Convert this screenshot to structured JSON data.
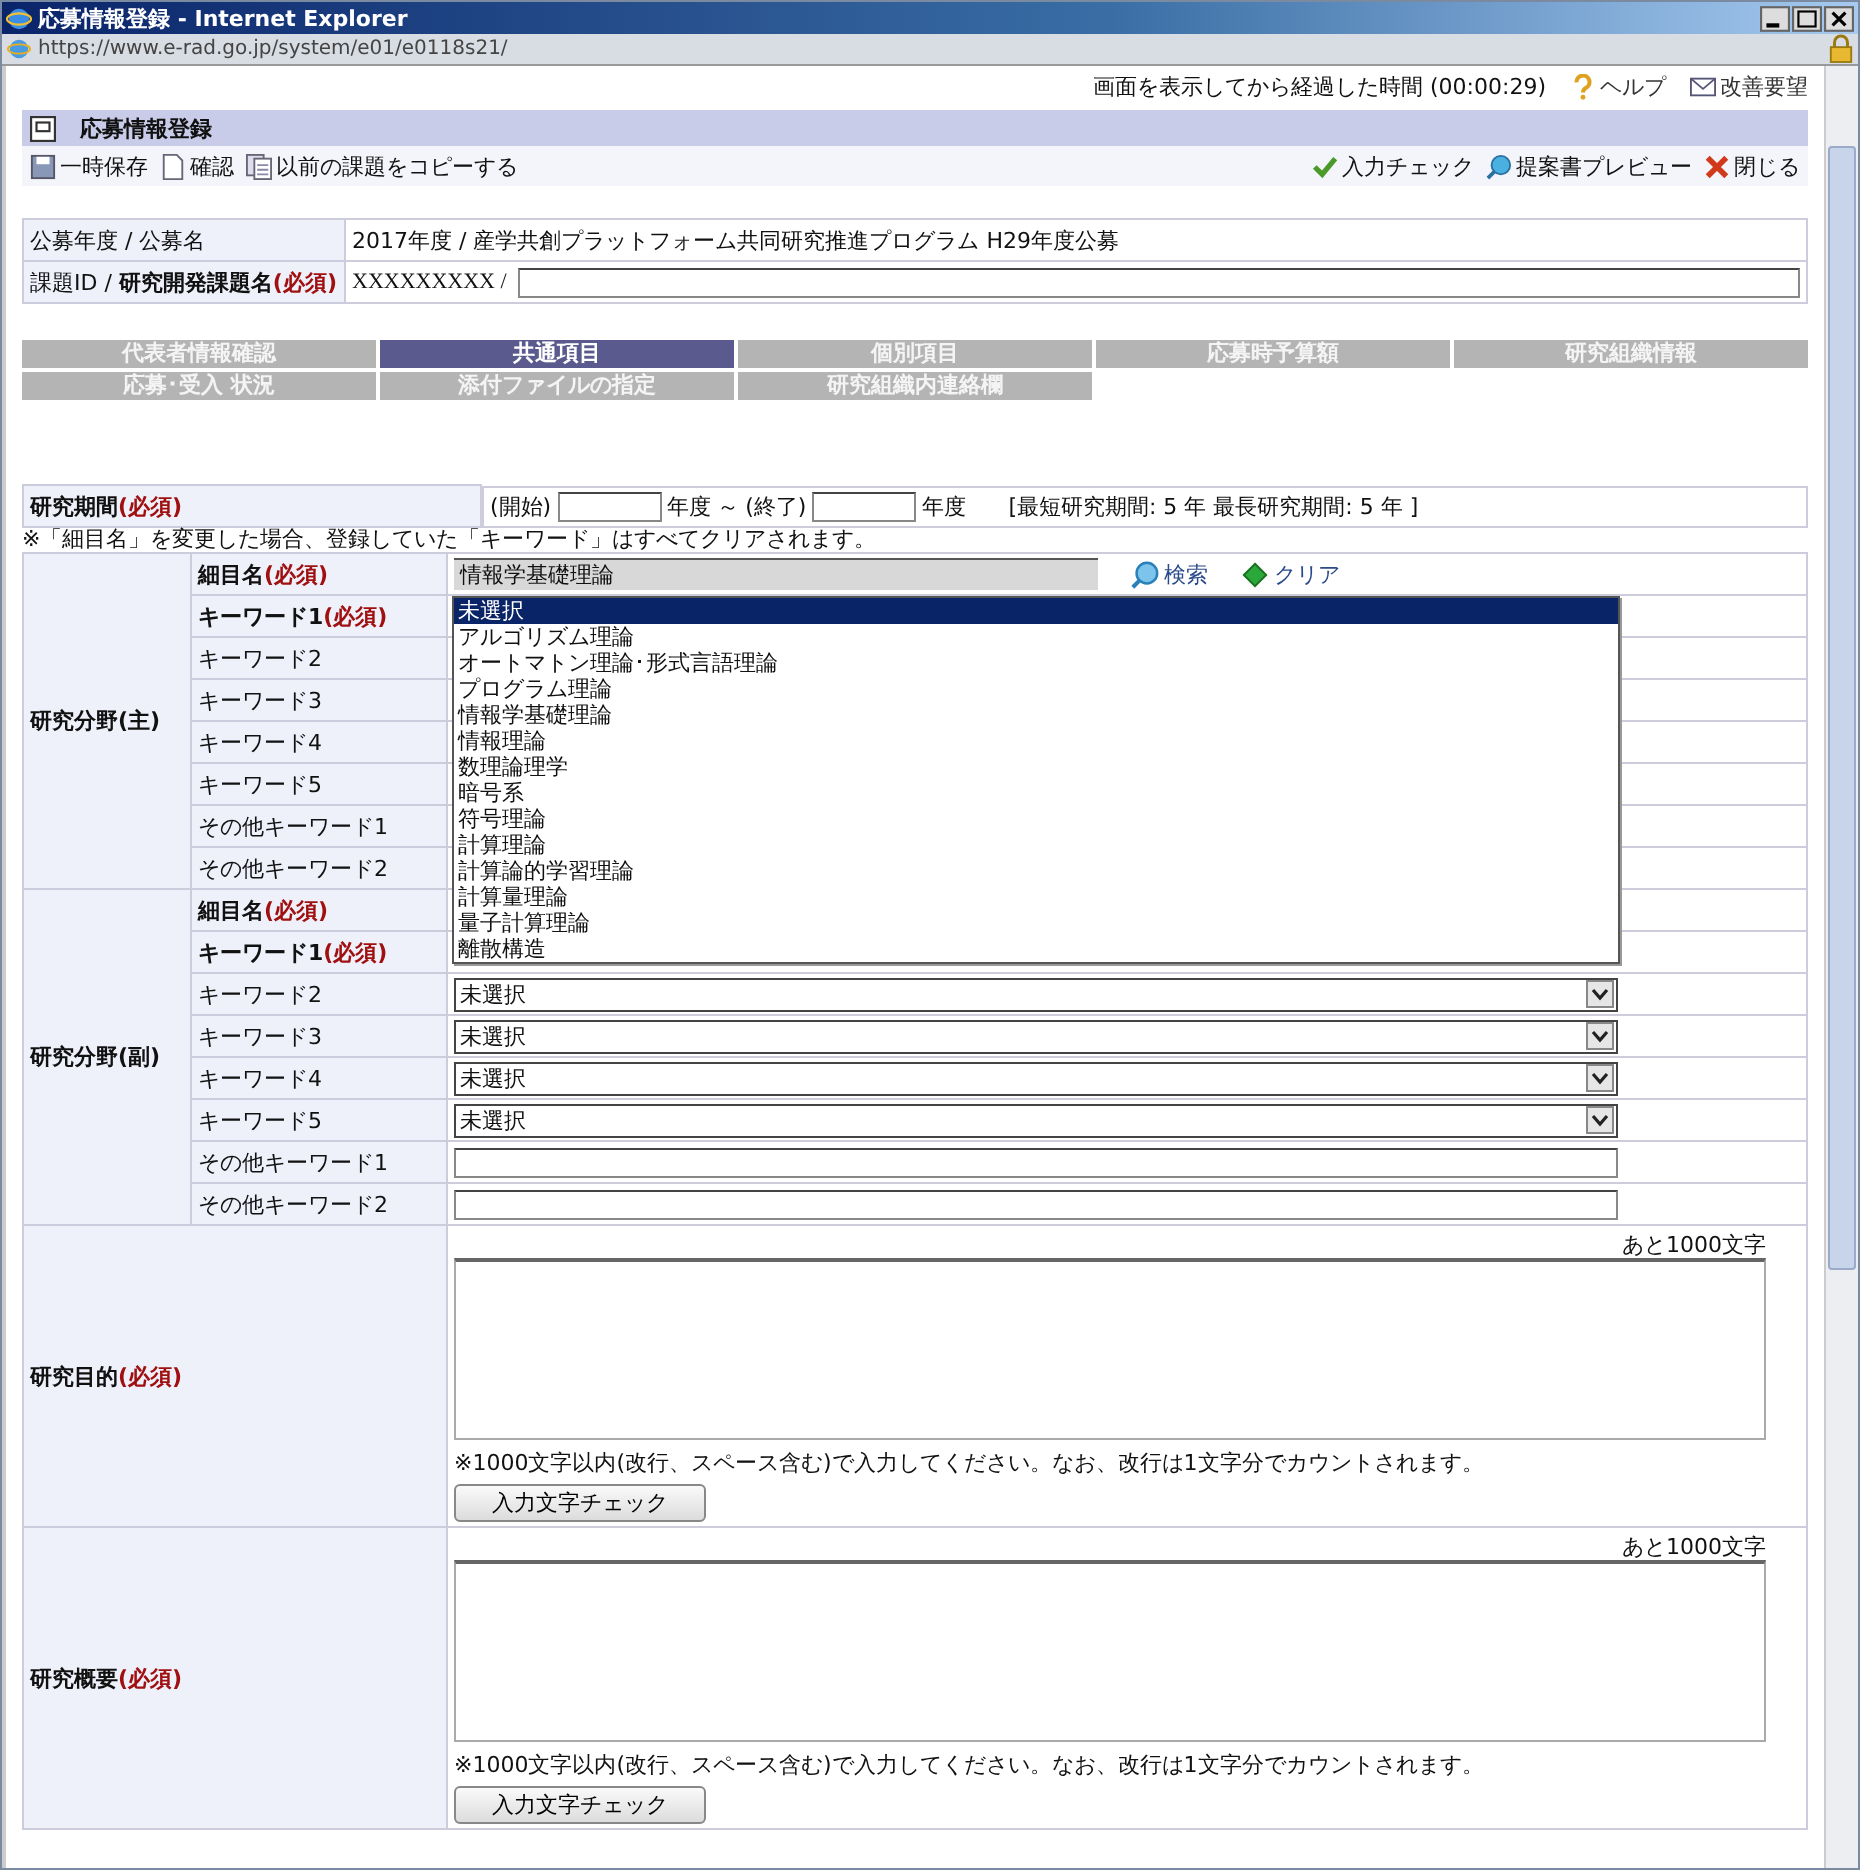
{
  "window": {
    "title": "応募情報登録 - Internet Explorer"
  },
  "address_bar": {
    "url": "https://www.e-rad.go.jp/system/e01/e0118s21/"
  },
  "top_bar": {
    "elapsed": "画面を表示してから経過した時間 (00:00:29)",
    "links": [
      {
        "label": "ヘルプ",
        "kind": "help"
      },
      {
        "label": "改善要望",
        "kind": "mail"
      }
    ]
  },
  "page_header": {
    "title": "応募情報登録"
  },
  "toolbar": {
    "left": [
      {
        "label": "一時保存",
        "kind": "save"
      },
      {
        "label": "確認",
        "kind": "doc"
      },
      {
        "label": "以前の課題をコピーする",
        "kind": "copy"
      }
    ],
    "right": [
      {
        "label": "入力チェック",
        "kind": "check"
      },
      {
        "label": "提案書プレビュー",
        "kind": "preview"
      },
      {
        "label": "閉じる",
        "kind": "close"
      }
    ]
  },
  "info_rows": [
    {
      "label": "公募年度 / 公募名",
      "kind": "text",
      "value": "2017年度 /  産学共創プラットフォーム共同研究推進プログラム  H29年度公募"
    },
    {
      "label": "課題ID / **研究開発課題名**",
      "required": "(必須)",
      "kind": "input",
      "value": "XXXXXXXXX /"
    }
  ],
  "tabs": [
    {
      "label": "代表者情報確認",
      "selected": false
    },
    {
      "label": "共通項目",
      "selected": true
    },
    {
      "label": "個別項目",
      "selected": false
    },
    {
      "label": "応募時予算額",
      "selected": false
    },
    {
      "label": "研究組織情報",
      "selected": false
    },
    {
      "label": "応募･受入 状況",
      "selected": false
    },
    {
      "label": "添付ファイルの指定",
      "selected": false
    },
    {
      "label": "研究組織内連絡欄",
      "selected": false
    }
  ],
  "period": {
    "label": "研究期間",
    "required": "(必須)",
    "start_label": "(開始)",
    "start_unit": "年度",
    "separator": "～",
    "end_label": "(終了)",
    "end_unit": "年度",
    "range": "[最短研究期間: 5 年  最長研究期間: 5 年 ]"
  },
  "note": "※「細目名」を変更した場合、登録していた「キーワード」はすべてクリアされます。",
  "field_groups": [
    {
      "label": "研究分野(主)",
      "rows": [
        {
          "label": "細目名",
          "required": "(必須)",
          "kind": "readonly",
          "value": "情報学基礎理論",
          "actions": [
            {
              "label": "検索",
              "kind": "search"
            },
            {
              "label": "クリア",
              "kind": "clear"
            }
          ]
        },
        {
          "label": "キーワード1",
          "required": "(必須)",
          "kind": "covered"
        },
        {
          "label": "キーワード2",
          "kind": "covered"
        },
        {
          "label": "キーワード3",
          "kind": "covered"
        },
        {
          "label": "キーワード4",
          "kind": "covered"
        },
        {
          "label": "キーワード5",
          "kind": "covered"
        },
        {
          "label": "その他キーワード1",
          "kind": "covered"
        },
        {
          "label": "その他キーワード2",
          "kind": "covered"
        }
      ]
    },
    {
      "label": "研究分野(副)",
      "rows": [
        {
          "label": "細目名",
          "required": "(必須)",
          "kind": "covered"
        },
        {
          "label": "キーワード1",
          "required": "(必須)",
          "kind": "covered"
        },
        {
          "label": "キーワード2",
          "kind": "select",
          "value": "未選択"
        },
        {
          "label": "キーワード3",
          "kind": "select",
          "value": "未選択"
        },
        {
          "label": "キーワード4",
          "kind": "select",
          "value": "未選択"
        },
        {
          "label": "キーワード5",
          "kind": "select",
          "value": "未選択"
        },
        {
          "label": "その他キーワード1",
          "kind": "text"
        },
        {
          "label": "その他キーワード2",
          "kind": "text"
        }
      ]
    }
  ],
  "dropdown": {
    "options": [
      {
        "label": "未選択",
        "selected": true
      },
      {
        "label": "アルゴリズム理論",
        "selected": false
      },
      {
        "label": "オートマトン理論･形式言語理論",
        "selected": false
      },
      {
        "label": "プログラム理論",
        "selected": false
      },
      {
        "label": "情報学基礎理論",
        "selected": false
      },
      {
        "label": "情報理論",
        "selected": false
      },
      {
        "label": "数理論理学",
        "selected": false
      },
      {
        "label": "暗号系",
        "selected": false
      },
      {
        "label": "符号理論",
        "selected": false
      },
      {
        "label": "計算理論",
        "selected": false
      },
      {
        "label": "計算論的学習理論",
        "selected": false
      },
      {
        "label": "計算量理論",
        "selected": false
      },
      {
        "label": "量子計算理論",
        "selected": false
      },
      {
        "label": "離散構造",
        "selected": false
      }
    ]
  },
  "text_sections": [
    {
      "label": "研究目的",
      "required": "(必須)",
      "remaining": "あと1000文字",
      "note": "※1000文字以内(改行、スペース含む)で入力してください。なお、改行は1文字分でカウントされます。",
      "button": "入力文字チェック"
    },
    {
      "label": "研究概要",
      "required": "(必須)",
      "remaining": "あと1000文字",
      "note": "※1000文字以内(改行、スペース含む)で入力してください。なお、改行は1文字分でカウントされます。",
      "button": "入力文字チェック"
    }
  ]
}
